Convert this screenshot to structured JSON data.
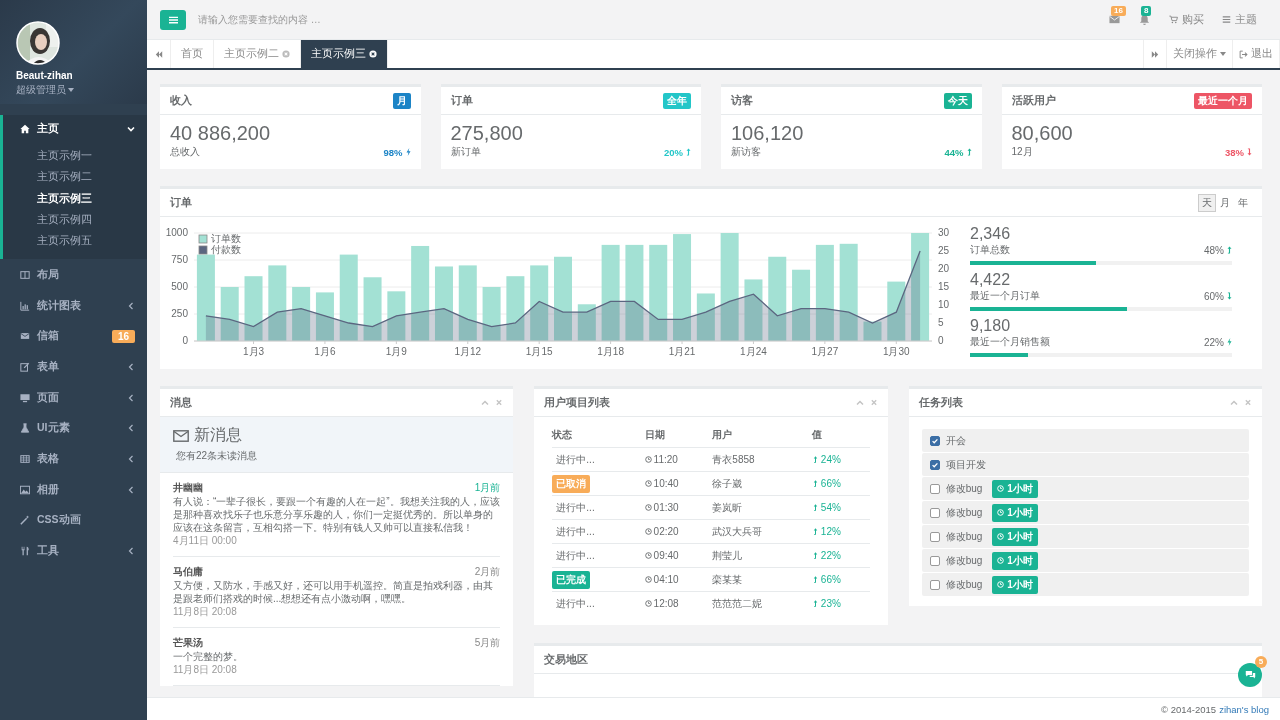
{
  "sidebar": {
    "profile": {
      "name": "Beaut-zihan",
      "role": "超级管理员"
    },
    "menu": [
      {
        "label": "主页",
        "kind": "group",
        "selected": true,
        "expanded": true,
        "children": [
          {
            "label": "主页示例一",
            "selected": false
          },
          {
            "label": "主页示例二",
            "selected": false
          },
          {
            "label": "主页示例三",
            "selected": true
          },
          {
            "label": "主页示例四",
            "selected": false
          },
          {
            "label": "主页示例五",
            "selected": false
          }
        ]
      },
      {
        "label": "布局",
        "kind": "link",
        "selected": false
      },
      {
        "label": "统计图表",
        "kind": "group",
        "selected": false,
        "expanded": false
      },
      {
        "label": "信箱",
        "kind": "link",
        "selected": false,
        "badge": "16"
      },
      {
        "label": "表单",
        "kind": "group",
        "selected": false,
        "expanded": false
      },
      {
        "label": "页面",
        "kind": "group",
        "selected": false,
        "expanded": false
      },
      {
        "label": "UI元素",
        "kind": "group",
        "selected": false,
        "expanded": false
      },
      {
        "label": "表格",
        "kind": "group",
        "selected": false,
        "expanded": false
      },
      {
        "label": "相册",
        "kind": "group",
        "selected": false,
        "expanded": false
      },
      {
        "label": "CSS动画",
        "kind": "link",
        "selected": false
      },
      {
        "label": "工具",
        "kind": "group",
        "selected": false,
        "expanded": false
      }
    ]
  },
  "topbar": {
    "search": {
      "placeholder": "请输入您需要查找的内容 …"
    },
    "mail_badge": "16",
    "bell_badge": "8",
    "buy": "购买",
    "theme": "主题"
  },
  "tabs": [
    {
      "label": "首页",
      "closable": false,
      "selected": false
    },
    {
      "label": "主页示例二",
      "closable": true,
      "selected": false
    },
    {
      "label": "主页示例三",
      "closable": true,
      "selected": true
    }
  ],
  "tab_actions": {
    "close_menu": "关闭操作",
    "logout": "退出"
  },
  "stats": [
    {
      "title": "收入",
      "tag": "月",
      "color": "#1c84c6",
      "value": "40 886,200",
      "caption": "总收入",
      "change": "98%",
      "kind": "bolt"
    },
    {
      "title": "订单",
      "tag": "全年",
      "color": "#23c6c8",
      "value": "275,800",
      "caption": "新订单",
      "change": "20%",
      "kind": "up"
    },
    {
      "title": "访客",
      "tag": "今天",
      "color": "#1ab394",
      "value": "106,120",
      "caption": "新访客",
      "change": "44%",
      "kind": "up"
    },
    {
      "title": "活跃用户",
      "tag": "最近一个月",
      "color": "#ed5565",
      "value": "80,600",
      "caption": "12月",
      "change": "38%",
      "kind": "down"
    }
  ],
  "orders_chart": {
    "title": "订单",
    "ranges": [
      {
        "label": "天",
        "selected": true
      },
      {
        "label": "月",
        "selected": false
      },
      {
        "label": "年",
        "selected": false
      }
    ],
    "chart_data": {
      "type": "bar",
      "categories": [
        null,
        null,
        "1月3",
        null,
        null,
        "1月6",
        null,
        null,
        "1月9",
        null,
        null,
        "1月12",
        null,
        null,
        "1月15",
        null,
        null,
        "1月18",
        null,
        null,
        "1月21",
        null,
        null,
        "1月24",
        null,
        null,
        "1月27",
        null,
        null,
        "1月30",
        null
      ],
      "grid": true,
      "legend": "upper left",
      "ylim": [
        0,
        1000
      ],
      "yticks": [
        0,
        250,
        500,
        750,
        1000
      ],
      "y2lim": [
        0,
        30
      ],
      "y2ticks": [
        0,
        5,
        10,
        15,
        20,
        25,
        30
      ],
      "series": [
        {
          "name": "订单数",
          "color": "#a3e1d4",
          "type": "bar",
          "values": [
            800,
            500,
            600,
            700,
            500,
            450,
            800,
            590,
            460,
            880,
            690,
            700,
            500,
            600,
            700,
            780,
            340,
            890,
            890,
            890,
            990,
            440,
            1000,
            570,
            780,
            660,
            890,
            900,
            180,
            550,
            1000
          ]
        },
        {
          "name": "付款数",
          "color": "#5b6680",
          "type": "area",
          "axis": "y2",
          "values": [
            7,
            6,
            4,
            8,
            9,
            7,
            5,
            4,
            7,
            8,
            9,
            6,
            4,
            5,
            11,
            8,
            8,
            11,
            11,
            6,
            6,
            8,
            11,
            13,
            7,
            9,
            9,
            8,
            5,
            8,
            25
          ]
        }
      ]
    },
    "summary": [
      {
        "value": "2,346",
        "label": "订单总数",
        "percent": "48%",
        "level": 0.48,
        "kind": "up"
      },
      {
        "value": "4,422",
        "label": "最近一个月订单",
        "percent": "60%",
        "level": 0.6,
        "kind": "down"
      },
      {
        "value": "9,180",
        "label": "最近一个月销售额",
        "percent": "22%",
        "level": 0.22,
        "kind": "bolt"
      }
    ]
  },
  "messages": {
    "title": "消息",
    "heading": "新消息",
    "subtitle": "您有22条未读消息",
    "items": [
      {
        "name": "井幽幽",
        "age": "1月前",
        "highlighted": true,
        "text": "有人说：“一辈子很长，要跟一个有趣的人在一起”。我想关注我的人，应该是那种喜欢找乐子也乐意分享乐趣的人，你们一定挺优秀的。所以单身的应该在这条留言，互相勾搭一下。特别有钱人又帅可以直接私信我！",
        "date": "4月11日 00:00"
      },
      {
        "name": "马伯庸",
        "age": "2月前",
        "highlighted": false,
        "text": "又方便，又防水，手感又好，还可以用手机遥控。简直是拍戏利器，由其是跟老师们搭戏的时候...想想还有点小激动啊，嘿嘿。",
        "date": "11月8日 20:08"
      },
      {
        "name": "芒果汤",
        "age": "5月前",
        "highlighted": false,
        "text": "一个完整的梦。",
        "date": "11月8日 20:08"
      }
    ]
  },
  "projects": {
    "title": "用户项目列表",
    "columns": [
      "状态",
      "日期",
      "用户",
      "值"
    ],
    "rows": [
      {
        "status": "进行中...",
        "kind": "plain",
        "time": "11:20",
        "user": "青衣5858",
        "value": "24%"
      },
      {
        "status": "已取消",
        "kind": "warning",
        "time": "10:40",
        "user": "徐子崴",
        "value": "66%"
      },
      {
        "status": "进行中...",
        "kind": "plain",
        "time": "01:30",
        "user": "姜岚昕",
        "value": "54%"
      },
      {
        "status": "进行中...",
        "kind": "plain",
        "time": "02:20",
        "user": "武汉大兵哥",
        "value": "12%"
      },
      {
        "status": "进行中...",
        "kind": "plain",
        "time": "09:40",
        "user": "荆莹儿",
        "value": "22%"
      },
      {
        "status": "已完成",
        "kind": "success",
        "time": "04:10",
        "user": "栾某某",
        "value": "66%"
      },
      {
        "status": "进行中...",
        "kind": "plain",
        "time": "12:08",
        "user": "范范范二妮",
        "value": "23%"
      }
    ]
  },
  "tasks": {
    "title": "任务列表",
    "items": [
      {
        "label": "开会",
        "checked": true
      },
      {
        "label": "项目开发",
        "checked": true
      },
      {
        "label": "修改bug",
        "checked": false,
        "tag": "1小时"
      },
      {
        "label": "修改bug",
        "checked": false,
        "tag": "1小时"
      },
      {
        "label": "修改bug",
        "checked": false,
        "tag": "1小时"
      },
      {
        "label": "修改bug",
        "checked": false,
        "tag": "1小时"
      },
      {
        "label": "修改bug",
        "checked": false,
        "tag": "1小时"
      }
    ]
  },
  "trade": {
    "title": "交易地区"
  },
  "chat_badge": "5",
  "footer": {
    "copyright": "© 2014-2015",
    "link": "zihan's blog"
  }
}
